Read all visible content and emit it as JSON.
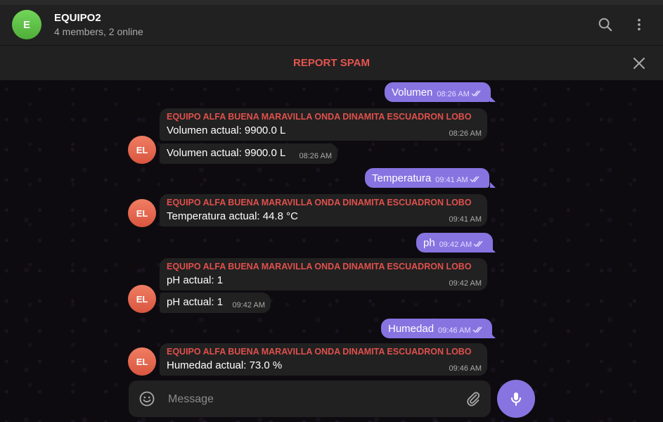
{
  "colors": {
    "accent": "#8774e1",
    "header_bg": "#212121",
    "incoming_bubble": "#212121",
    "sender_name": "#e0504c",
    "spam": "#e5544f",
    "group_avatar": "#5cc048",
    "member_avatar": "#e8664d"
  },
  "header": {
    "avatar_letter": "E",
    "title": "EQUIPO2",
    "subtitle": "4 members, 2 online",
    "search_icon": "search-icon",
    "menu_icon": "more-vertical-icon"
  },
  "spam_bar": {
    "label": "REPORT SPAM",
    "close_icon": "close-icon"
  },
  "messages": [
    {
      "type": "outgoing",
      "text": "Volumen",
      "time": "08:26 AM",
      "status": "read"
    },
    {
      "type": "incoming",
      "sender": "EQUIPO ALFA BUENA MARAVILLA ONDA DINAMITA ESCUADRON LOBO",
      "text": "Volumen actual: 9900.0 L",
      "time": "08:26 AM"
    },
    {
      "type": "incoming",
      "text": "Volumen actual: 9900.0 L",
      "time": "08:26 AM",
      "avatar": "EL"
    },
    {
      "type": "outgoing",
      "text": "Temperatura",
      "time": "09:41 AM",
      "status": "read"
    },
    {
      "type": "incoming",
      "sender": "EQUIPO ALFA BUENA MARAVILLA ONDA DINAMITA ESCUADRON LOBO",
      "text": "Temperatura actual: 44.8 °C",
      "time": "09:41 AM",
      "avatar": "EL"
    },
    {
      "type": "outgoing",
      "text": "ph",
      "time": "09:42 AM",
      "status": "read"
    },
    {
      "type": "incoming",
      "sender": "EQUIPO ALFA BUENA MARAVILLA ONDA DINAMITA ESCUADRON LOBO",
      "text": "pH actual: 1",
      "time": "09:42 AM"
    },
    {
      "type": "incoming",
      "text": "pH actual: 1",
      "time": "09:42 AM",
      "avatar": "EL"
    },
    {
      "type": "outgoing",
      "text": "Humedad",
      "time": "09:46 AM",
      "status": "read"
    },
    {
      "type": "incoming",
      "sender": "EQUIPO ALFA BUENA MARAVILLA ONDA DINAMITA ESCUADRON LOBO",
      "text": "Humedad actual: 73.0 %",
      "time": "09:46 AM",
      "avatar": "EL"
    }
  ],
  "composer": {
    "placeholder": "Message",
    "value": "",
    "emoji_icon": "smile-icon",
    "attach_icon": "paperclip-icon",
    "mic_icon": "microphone-icon"
  }
}
